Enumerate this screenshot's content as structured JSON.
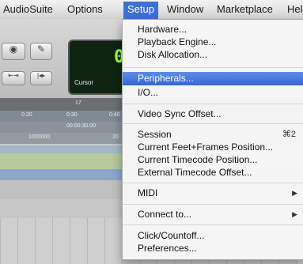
{
  "menubar": {
    "items": [
      "AudioSuite",
      "Options",
      "Setup",
      "Window",
      "Marketplace",
      "Hel"
    ]
  },
  "toolbar": {
    "counter_digit": "0",
    "counter_label": "Cursor"
  },
  "ruler": {
    "marker": "17",
    "times": [
      "0:20",
      "0:30",
      "0:40"
    ],
    "timecode": "00:00:30:00",
    "samples": "1000000",
    "samples2": "20"
  },
  "setup_menu": {
    "hardware": "Hardware...",
    "playback_engine": "Playback Engine...",
    "disk_allocation": "Disk Allocation...",
    "peripherals": "Peripherals...",
    "io": "I/O...",
    "video_sync_offset": "Video Sync Offset...",
    "session": "Session",
    "session_shortcut": "⌘2",
    "current_feet_frames": "Current Feet+Frames Position...",
    "current_timecode": "Current Timecode Position...",
    "external_timecode": "External Timecode Offset...",
    "midi": "MIDI",
    "connect_to": "Connect to...",
    "click_countoff": "Click/Countoff...",
    "preferences": "Preferences..."
  },
  "colors": {
    "menu_highlight": "#3d6fd6",
    "counter_green": "#9cff4a"
  }
}
